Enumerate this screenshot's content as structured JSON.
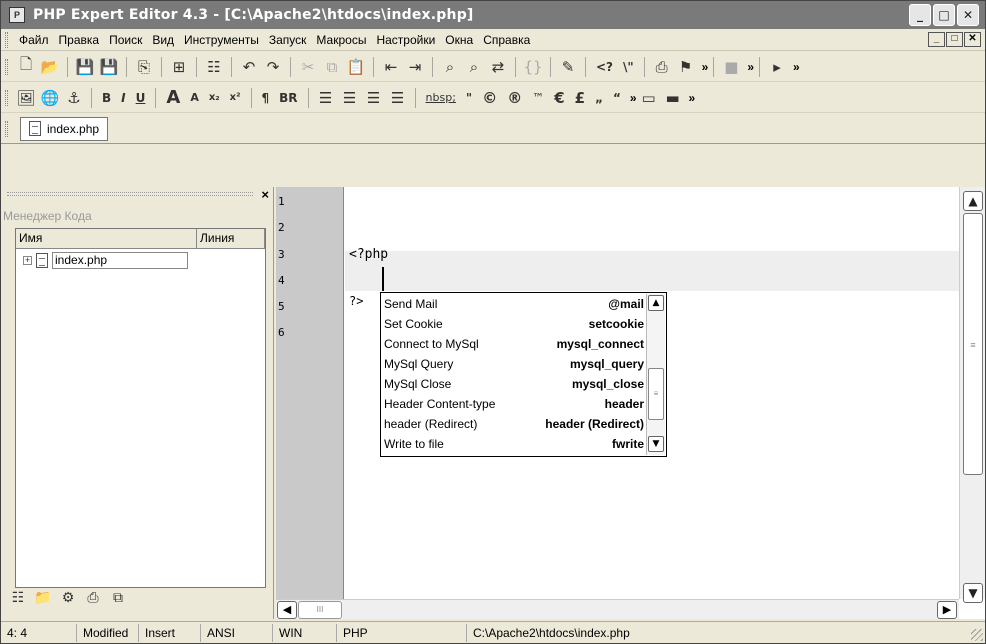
{
  "window": {
    "title": "PHP Expert Editor 4.3 - [C:\\Apache2\\htdocs\\index.php]",
    "app_icon": "app-icon",
    "buttons": [
      "minimize-icon",
      "maximize-icon",
      "close-icon"
    ]
  },
  "menubar": {
    "items": [
      "Файл",
      "Правка",
      "Поиск",
      "Вид",
      "Инструменты",
      "Запуск",
      "Макросы",
      "Настройки",
      "Окна",
      "Справка"
    ]
  },
  "toolbar1": {
    "icons": [
      "new-file-icon",
      "open-folder-icon",
      "save-icon",
      "save-all-icon",
      "close-file-icon",
      "clipboard-grid-icon",
      "code-tree-icon",
      "undo-icon",
      "redo-icon",
      "cut-icon",
      "copy-icon",
      "paste-icon",
      "indent-icon",
      "outdent-icon",
      "find-icon",
      "find-next-icon",
      "replace-icon",
      "brackets-icon",
      "pen-icon"
    ],
    "text_buttons": [
      "<?",
      "\\\"",
      "»",
      "»",
      "»"
    ]
  },
  "toolbar2": {
    "format_labels": {
      "bold": "B",
      "italic": "I",
      "underline": "U",
      "font_bigger": "A",
      "font_smaller": "A",
      "subscript": "x₂",
      "superscript": "x²",
      "paragraph": "¶",
      "line_break": "BR",
      "nbsp": "nbsp;",
      "quote": "\"",
      "copyright": "©",
      "registered": "®",
      "trademark": "™",
      "euro": "€",
      "pound": "£",
      "low_quote": "„",
      "left_quote": "“",
      "more": "»"
    }
  },
  "tabs": [
    {
      "label": "index.php"
    }
  ],
  "code_manager": {
    "title": "Менеджер Кода",
    "columns": [
      "Имя",
      "Линия"
    ],
    "items": [
      {
        "label": "index.php",
        "expander": "+"
      }
    ]
  },
  "editor": {
    "line_numbers": [
      "1",
      "2",
      "3",
      "4",
      "5",
      "6"
    ],
    "lines": {
      "l3": "<?php",
      "l5": "?>"
    }
  },
  "autocomplete": {
    "items": [
      {
        "label": "Send Mail",
        "keyword": "@mail"
      },
      {
        "label": "Set Cookie",
        "keyword": "setcookie"
      },
      {
        "label": "Connect to MySql",
        "keyword": "mysql_connect"
      },
      {
        "label": "MySql Query",
        "keyword": "mysql_query"
      },
      {
        "label": "MySql Close",
        "keyword": "mysql_close"
      },
      {
        "label": "Header Content-type",
        "keyword": "header"
      },
      {
        "label": "header (Redirect)",
        "keyword": "header (Redirect)"
      },
      {
        "label": "Write to file",
        "keyword": "fwrite"
      }
    ]
  },
  "statusbar": {
    "position": "4: 4",
    "modified": "Modified",
    "mode": "Insert",
    "encoding": "ANSI",
    "line_endings": "WIN",
    "syntax": "PHP",
    "path": "C:\\Apache2\\htdocs\\index.php"
  }
}
